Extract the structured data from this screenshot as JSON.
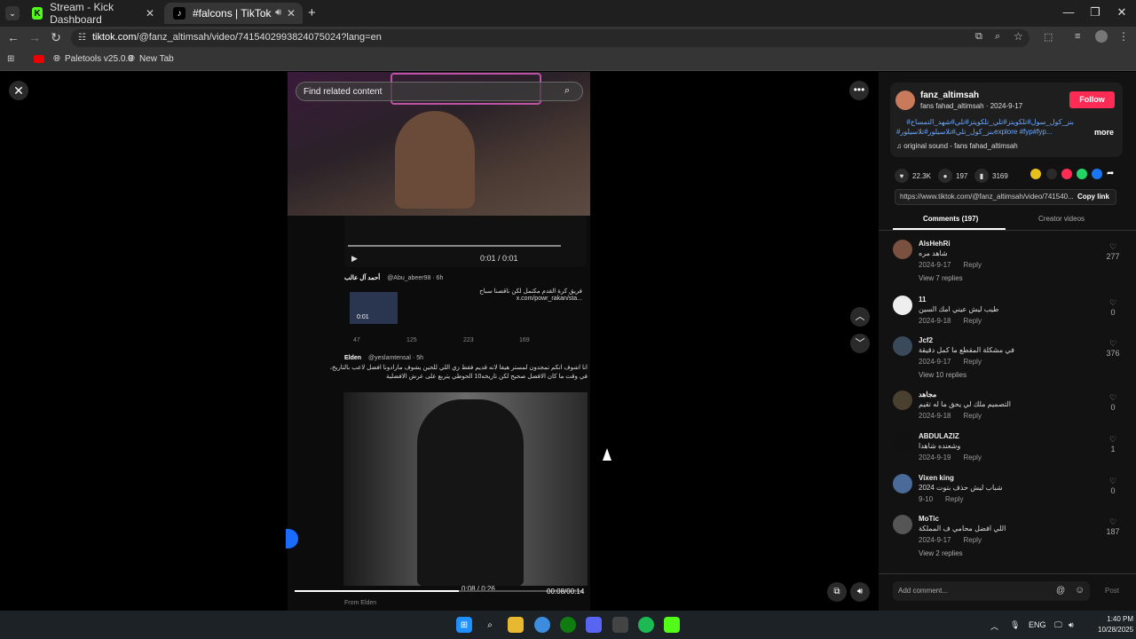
{
  "browser": {
    "tabs": [
      {
        "label": "Stream - Kick Dashboard",
        "active": false,
        "icon": "kick-icon"
      },
      {
        "label": "#falcons | TikTok",
        "active": true,
        "icon": "tiktok-icon"
      }
    ],
    "url_domain": "tiktok.com",
    "url_path": "/@fanz_altimsah/video/7415402993824075024?lang=en",
    "bookmarks": [
      {
        "label": "Paletools v25.0.0",
        "icon": "globe-icon"
      },
      {
        "label": "New Tab",
        "icon": "globe-icon"
      }
    ]
  },
  "video": {
    "search_placeholder": "Find related content",
    "clip_time": "0:01 / 0:01",
    "tweet_author": "أحمد آل عالب",
    "tweet_handle": "@Abu_abeer98 · 6h",
    "tweet_text_1": "فريق كرة القدم مكتمل لكن ناقصنا سباح",
    "tweet_text_2": "x.com/powr_rakan/sta...",
    "tweet_thumb_time": "0:01",
    "tweet_stats": [
      "47",
      "125",
      "223",
      "169"
    ],
    "tweet2_author": "Elden",
    "tweet2_handle": "@yeslamtensal · 5h",
    "tweet2_text": "انا اشوف انكم تمجدون لمستر هيفا لانه قديم فقط زي اللي للحين يشوف مارادونا افضل لاعب بالتاريخ، في وقت ما كان الافضل صحيح لكن تاريخه10 الحوطي يتربع على عرش الافضلية",
    "inner_time": "0:08 / 0:26",
    "main_time": "00:08/00:14",
    "from_label": "From Elden",
    "progress": 0.57
  },
  "post": {
    "username": "fanz_altimsah",
    "subtitle": "fans fahad_altimsah · 2024-9-17",
    "follow_label": "Follow",
    "description_line1": "#بنز_كول_سول#تلكويتز#تلي_تلكويتز#تلي#شهد_التمساح",
    "description_line2": "#بنز_كول_تلي#تلاسيلور#تلاسيلورexplore #fyp#fyp...",
    "more_label": "more",
    "sound": "original sound - fans fahad_altimsah",
    "likes": "22.3K",
    "comments_count": "197",
    "saves": "3169",
    "link": "https://www.tiktok.com/@fanz_altimsah/video/741540...",
    "copy_link_label": "Copy link",
    "tab_comments": "Comments (197)",
    "tab_creator": "Creator videos"
  },
  "comments": [
    {
      "name": "AlsHehRi",
      "text": "شاهد مره",
      "date": "2024-9-17",
      "reply": "Reply",
      "likes": "277",
      "replies": "View 7 replies"
    },
    {
      "name": "11",
      "text": "طيب ليش عيني امك السين",
      "date": "2024-9-18",
      "reply": "Reply",
      "likes": "0",
      "replies": ""
    },
    {
      "name": "Jcf2",
      "text": "في مشكلة المقطع ما كمل دقيقة",
      "date": "2024-9-17",
      "reply": "Reply",
      "likes": "376",
      "replies": "View 10 replies"
    },
    {
      "name": "مجاهد",
      "text": "التصميم ملك لي يحق ما له تقيم",
      "date": "2024-9-18",
      "reply": "Reply",
      "likes": "0",
      "replies": ""
    },
    {
      "name": "ABDULAZIZ",
      "text": "وشعنده شاهدا",
      "date": "2024-9-19",
      "reply": "Reply",
      "likes": "1",
      "replies": ""
    },
    {
      "name": "Vixen king",
      "text": "شباب ليش حذف بتوت 2024",
      "date": "9-10",
      "reply": "Reply",
      "likes": "0",
      "replies": ""
    },
    {
      "name": "MoTic",
      "text": "اللي افضل محامي ف المملكة",
      "date": "2024-9-17",
      "reply": "Reply",
      "likes": "187",
      "replies": "View 2 replies"
    }
  ],
  "comment_box": {
    "placeholder": "Add comment...",
    "post_label": "Post"
  },
  "taskbar": {
    "lang": "ENG",
    "time": "1:40 PM",
    "date": "10/28/2025"
  },
  "colors": {
    "accent": "#fe2c55",
    "hashtag": "#6aa8ff",
    "panel": "#121212"
  }
}
